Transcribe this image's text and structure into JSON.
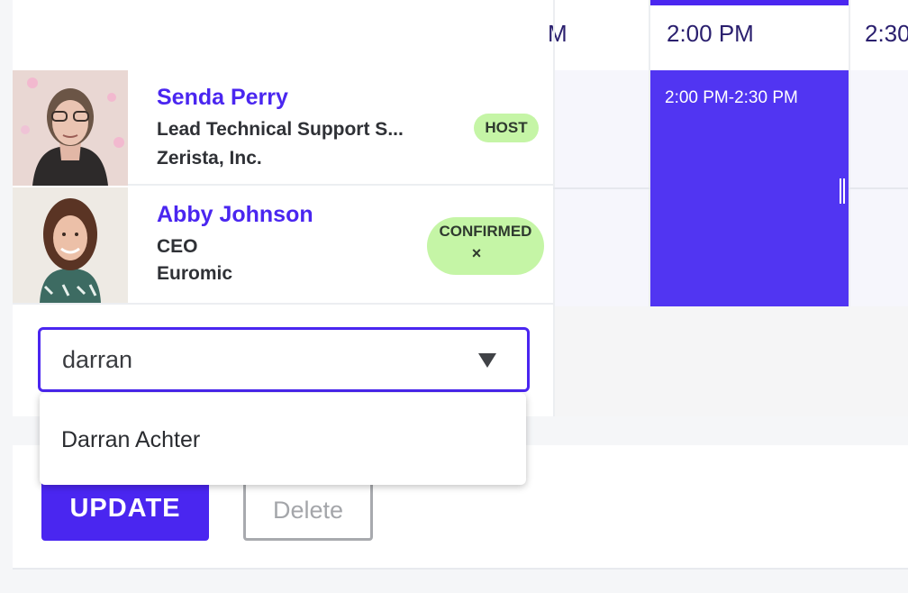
{
  "timeline": {
    "headers": [
      "M",
      "2:00 PM",
      "2:30"
    ],
    "event_label": "2:00 PM-2:30 PM"
  },
  "people": [
    {
      "name": "Senda Perry",
      "title": "Lead Technical Support S...",
      "company": "Zerista, Inc.",
      "badge": "HOST"
    },
    {
      "name": "Abby Johnson",
      "title": "CEO",
      "company": "Euromic",
      "badge": "CONFIRMED",
      "badge_close": "×"
    }
  ],
  "search": {
    "value": "darran"
  },
  "dropdown": {
    "options": [
      "Darran Achter"
    ]
  },
  "actions": {
    "update_label": "UPDATE",
    "delete_label": "Delete"
  },
  "colors": {
    "accent": "#4a26f0",
    "event": "#5135f2",
    "badge": "#c5f5a6"
  }
}
